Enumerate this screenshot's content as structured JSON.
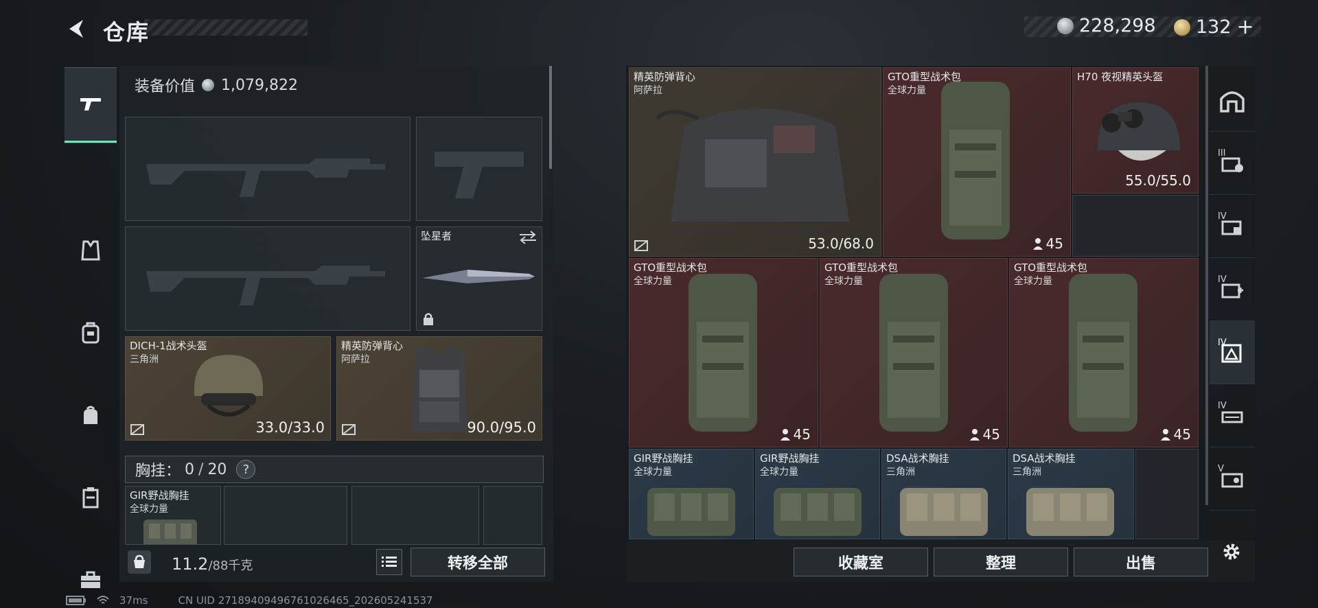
{
  "header": {
    "title": "仓库"
  },
  "currencies": [
    {
      "icon": "silver-coin-icon",
      "value": "228,298"
    },
    {
      "icon": "gold-coin-icon",
      "value": "132",
      "add": "+"
    }
  ],
  "equipment": {
    "label": "装备价值",
    "value": "1,079,822"
  },
  "slots": {
    "melee": {
      "name": "坠星者"
    },
    "helmet": {
      "name": "DICH-1战术头盔",
      "origin": "三角洲",
      "durability": "33.0/33.0"
    },
    "armor": {
      "name": "精英防弹背心",
      "origin": "阿萨拉",
      "durability": "90.0/95.0"
    }
  },
  "rig": {
    "label": "胸挂：",
    "current": "0",
    "max": "20",
    "help": "?"
  },
  "rig_item": {
    "name": "GIR野战胸挂",
    "origin": "全球力量"
  },
  "weight": {
    "value": "11.2",
    "max": "/88千克"
  },
  "buttons": {
    "transfer_all": "转移全部",
    "collection": "收藏室",
    "organize": "整理",
    "sell": "出售"
  },
  "warehouse": [
    {
      "name": "精英防弹背心",
      "origin": "阿萨拉",
      "durability": "53.0/68.0"
    },
    {
      "name": "GTO重型战术包",
      "origin": "全球力量",
      "count": "45"
    },
    {
      "name": "H70 夜视精英头盔",
      "origin": "",
      "durability": "55.0/55.0"
    },
    {
      "name": "GTO重型战术包",
      "origin": "全球力量",
      "count": "45"
    },
    {
      "name": "GTO重型战术包",
      "origin": "全球力量",
      "count": "45"
    },
    {
      "name": "GTO重型战术包",
      "origin": "全球力量",
      "count": "45"
    },
    {
      "name": "GIR野战胸挂",
      "origin": "全球力量"
    },
    {
      "name": "GIR野战胸挂",
      "origin": "全球力量"
    },
    {
      "name": "DSA战术胸挂",
      "origin": "三角洲"
    },
    {
      "name": "DSA战术胸挂",
      "origin": "三角洲"
    }
  ],
  "right_tabs": [
    "III",
    "IV",
    "IV",
    "IV",
    "IV",
    "V"
  ],
  "status": {
    "ping": "37ms",
    "uid": "CN UID 27189409496761026465_202605241537"
  }
}
